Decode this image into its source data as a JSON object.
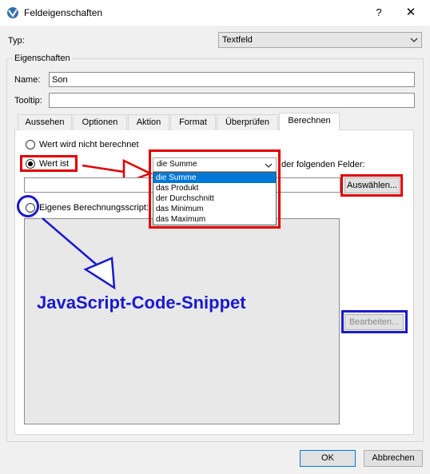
{
  "window": {
    "title": "Feldeigenschaften",
    "help": "?",
    "close": "✕"
  },
  "typ": {
    "label": "Typ:",
    "value": "Textfeld"
  },
  "eigenschaften": {
    "legend": "Eigenschaften",
    "name_label": "Name:",
    "name_value": "Son",
    "tooltip_label": "Tooltip:",
    "tooltip_value": ""
  },
  "tabs": [
    "Aussehen",
    "Optionen",
    "Aktion",
    "Format",
    "Überprüfen",
    "Berechnen"
  ],
  "calc": {
    "radio_none": "Wert wird nicht berechnet",
    "radio_value": "Wert ist",
    "select_value": "die Summe",
    "fields_suffix": "der folgenden Felder:",
    "dropdown_options": [
      "die Summe",
      "das Produkt",
      "der Durchschnitt",
      "das Minimum",
      "das Maximum"
    ],
    "choose_button": "Auswählen...",
    "radio_script": "Eigenes Berechnungsscript:",
    "edit_button": "Bearbeiten..."
  },
  "annotation": {
    "text": "JavaScript-Code-Snippet"
  },
  "footer": {
    "ok": "OK",
    "cancel": "Abbrechen"
  },
  "colors": {
    "red_highlight": "#e00000",
    "blue_highlight": "#1a1acc",
    "selection": "#0078d7"
  }
}
